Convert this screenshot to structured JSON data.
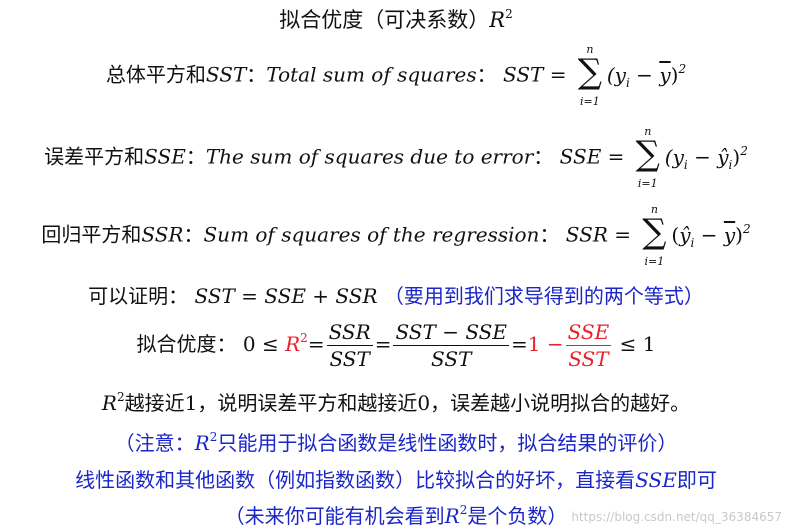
{
  "title": {
    "prefix": "拟合优度（可决系数）",
    "sym": "R",
    "exp": "2"
  },
  "sst_def": {
    "label": "总体平方和",
    "abbr": "SST",
    "colon1": "：",
    "english": "Total sum of squares",
    "colon2": "：",
    "lhs": "SST",
    "eq": "=",
    "sum_top": "n",
    "sum_bottom": "i=1",
    "term": "(y",
    "term_sub": "i",
    "term2": " − ",
    "term_bar": "y",
    "term_close": ")",
    "term_exp": "2"
  },
  "sse_def": {
    "label": "误差平方和",
    "abbr": "SSE",
    "colon1": "：",
    "english": "The sum of squares due to error",
    "colon2": "：",
    "lhs": "SSE",
    "eq": "=",
    "sum_top": "n",
    "sum_bottom": "i=1",
    "term": "(y",
    "term_sub": "i",
    "term2": " − ",
    "term_hat": "ŷ",
    "term_hat_sub": "i",
    "term_close": ")",
    "term_exp": "2"
  },
  "ssr_def": {
    "label": "回归平方和",
    "abbr": "SSR",
    "colon1": "：",
    "english": "Sum of squares of the regression",
    "colon2": "：",
    "lhs": "SSR",
    "eq": "=",
    "sum_top": "n",
    "sum_bottom": "i=1",
    "term": "(",
    "term_hat": "ŷ",
    "term_hat_sub": "i",
    "term2": " − ",
    "term_bar": "y",
    "term_close": ")",
    "term_exp": "2"
  },
  "proof": {
    "label": "可以证明：",
    "formula": "SST = SSE + SSR",
    "note": "（要用到我们求导得到的两个等式）"
  },
  "r2_line": {
    "label": "拟合优度：",
    "zero": "0",
    "leq1": "≤",
    "r": "R",
    "r_exp": "2",
    "eq1": "=",
    "frac1_num": "SSR",
    "frac1_den": "SST",
    "eq2": "=",
    "frac2_num": "SST − SSE",
    "frac2_den": "SST",
    "eq3": "=",
    "one_minus": "1 −",
    "frac3_num": "SSE",
    "frac3_den": "SST",
    "leq2": "≤",
    "one": "1"
  },
  "conclusion": {
    "r": "R",
    "r_exp": "2",
    "text": "越接近1，说明误差平方和越接近0，误差越小说明拟合的越好。"
  },
  "note1": {
    "prefix": "（注意：",
    "r": "R",
    "r_exp": "2",
    "text": "只能用于拟合函数是线性函数时，拟合结果的评价）"
  },
  "note2": {
    "text": "线性函数和其他函数（例如指数函数）比较拟合的好坏，直接看",
    "abbr": "SSE",
    "suffix": "即可"
  },
  "note3": {
    "prefix": "（未来你可能有机会看到",
    "r": "R",
    "r_exp": "2",
    "suffix": "是个负数）"
  },
  "watermark": "https://blog.csdn.net/qq_36384657",
  "colors": {
    "text": "#111111",
    "red": "#e8202a",
    "blue": "#1a26c8",
    "watermark": "#c9c9c9"
  }
}
